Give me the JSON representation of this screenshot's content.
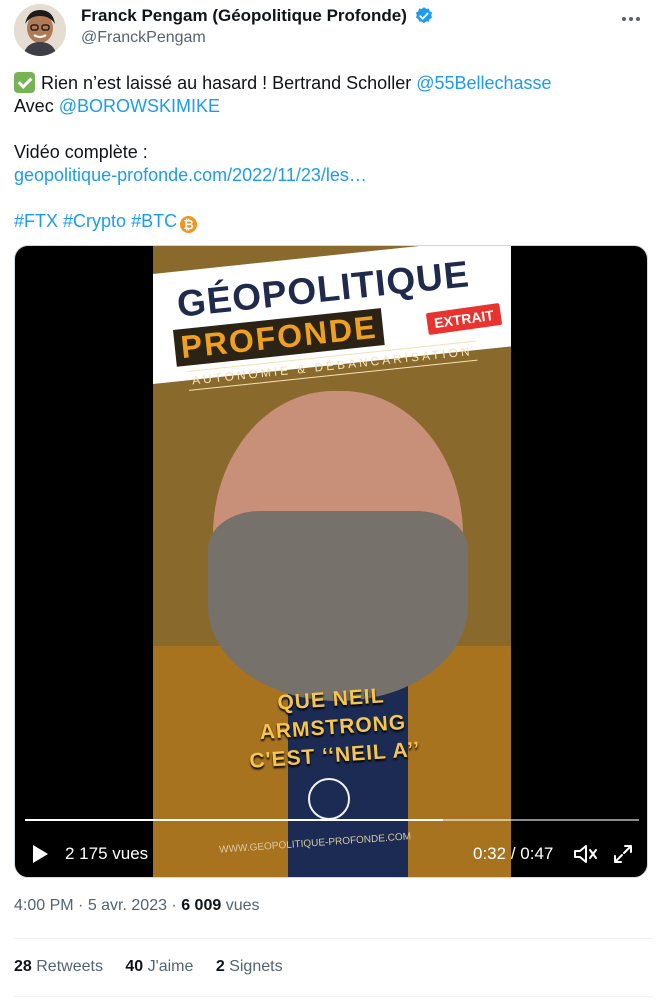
{
  "author": {
    "display_name": "Franck Pengam (Géopolitique Profonde)",
    "handle": "@FranckPengam",
    "avatar": "avatar-photo",
    "verified": true
  },
  "icons": {
    "check": "check-mark-button-emoji",
    "bitcoin": "bitcoin-icon",
    "more": "more-horizontal-icon"
  },
  "colors": {
    "link": "#1d9bf0",
    "verified": "#1d9bf0",
    "bitcoin": "#f7931a",
    "text": "#0f1419",
    "secondary": "#536471"
  },
  "tweet": {
    "line1_text": "Rien n’est laissé au hasard ! Bertrand Scholler ",
    "line1_mention": "@55Bellechasse",
    "line2_text": "Avec ",
    "line2_mention": "@BOROWSKIMIKE",
    "line3_text": "Vidéo complète :",
    "url": "geopolitique-profonde.com/2022/11/23/les…",
    "hashtags": [
      "#FTX",
      "#Crypto",
      "#BTC"
    ],
    "bitcoin_glyph": "₿"
  },
  "video": {
    "brand_line1": "GÉOPOLITIQUE",
    "brand_line2": "PROFONDE",
    "badge": "EXTRAIT",
    "tagline": "AUTONOMIE & DÉBANCARISATION",
    "caption_lines": [
      "QUE NEIL",
      "ARMSTRONG",
      "C'EST ‘‘NEIL A’’"
    ],
    "watermark": "WWW.GEOPOLITIQUE-PROFONDE.COM",
    "views": "2 175 vues",
    "time_current": "0:32",
    "time_separator": " / ",
    "time_total": "0:47",
    "progress": 0.68
  },
  "meta": {
    "time": "4:00 PM",
    "date": "5 avr. 2023",
    "views_count": "6 009",
    "views_label": "vues",
    "separator": " · "
  },
  "stats": [
    {
      "count": "28",
      "label": "Retweets"
    },
    {
      "count": "40",
      "label": "J'aime"
    },
    {
      "count": "2",
      "label": "Signets"
    }
  ]
}
